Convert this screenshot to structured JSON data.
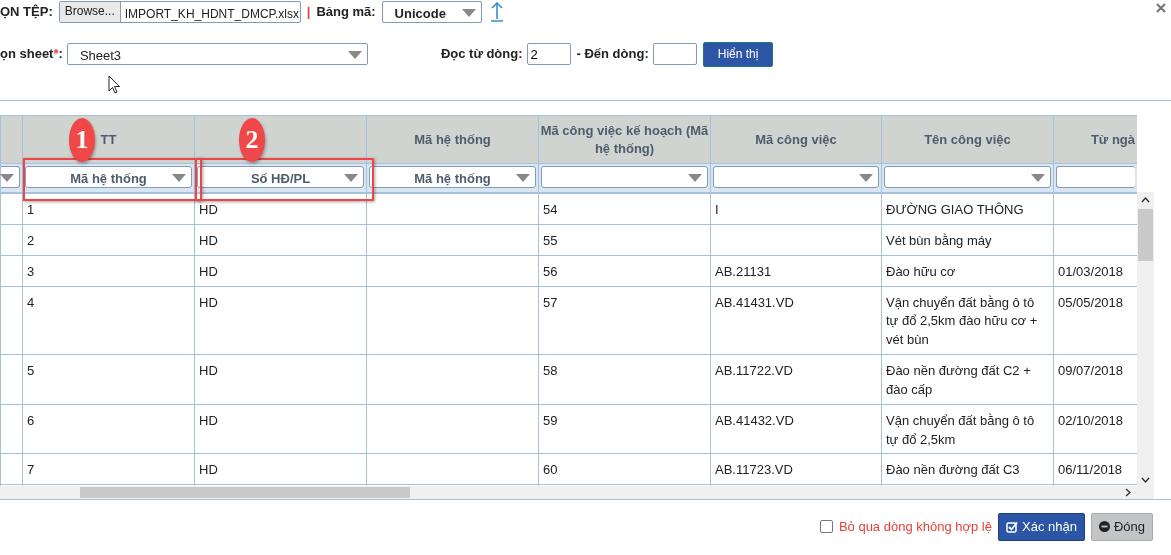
{
  "file_row": {
    "file_label": "ỌN TỆP:",
    "browse_button": "Browse...",
    "file_name": "IMPORT_KH_HDNT_DMCP.xlsx",
    "separator": "|",
    "encoding_label": "Bảng mã:",
    "encoding_value": "Unicode"
  },
  "sheet_row": {
    "sheet_label": "ọn sheet",
    "required_mark": "*",
    "sheet_label_colon": ":",
    "sheet_value": "Sheet3",
    "from_label": "Đọc từ dòng:",
    "from_value": "2",
    "to_label": "- Đến dòng:",
    "show_button": "Hiển thị"
  },
  "table": {
    "columns": [
      {
        "filter_caret": true
      },
      {
        "title": "TT",
        "filter": "Mã hệ thống",
        "filter_caret": true,
        "annotation": "1"
      },
      {
        "filter": "Số HĐ/PL",
        "filter_caret": true,
        "annotation": "2"
      },
      {
        "title": "Mã hệ thống",
        "filter": "Mã hệ thống",
        "filter_caret": true
      },
      {
        "title": "Mã công việc kế hoạch (Mã hệ thống)",
        "filter_caret": true
      },
      {
        "title": "Mã công việc",
        "filter_caret": true
      },
      {
        "title": "Tên công việc",
        "filter_caret": true
      },
      {
        "title": "Từ ngà",
        "filter_caret": false
      }
    ],
    "rows": [
      {
        "cells": [
          null,
          "1",
          "HD",
          null,
          "54",
          "I",
          "ĐƯỜNG GIAO THÔNG",
          null
        ]
      },
      {
        "cells": [
          null,
          "2",
          "HD",
          null,
          "55",
          null,
          "Vét bùn bằng máy",
          null
        ]
      },
      {
        "cells": [
          null,
          "3",
          "HD",
          null,
          "56",
          "AB.21131",
          "Đào hữu cơ",
          "01/03/2018"
        ]
      },
      {
        "cells": [
          null,
          "4",
          "HD",
          null,
          "57",
          "AB.41431.VD",
          "Vận chuyển đất bằng ô tô tự đổ 2,5km đào hữu cơ + vét bùn",
          "05/05/2018"
        ]
      },
      {
        "cells": [
          null,
          "5",
          "HD",
          null,
          "58",
          "AB.11722.VD",
          "Đào nền đường đất C2 + đào cấp",
          "09/07/2018"
        ]
      },
      {
        "cells": [
          null,
          "6",
          "HD",
          null,
          "59",
          "AB.41432.VD",
          "Vận chuyển đất bằng ô tô tự đổ 2,5km",
          "02/10/2018"
        ]
      },
      {
        "cells": [
          null,
          "7",
          "HD",
          null,
          "60",
          "AB.11723.VD",
          "Đào nền đường đất C3",
          "06/11/2018"
        ]
      }
    ]
  },
  "footer": {
    "skip_invalid": {
      "label": "Bỏ qua dòng không hợp lệ",
      "checked": false
    },
    "confirm_button": "Xác nhận",
    "close_button": "Đóng"
  }
}
